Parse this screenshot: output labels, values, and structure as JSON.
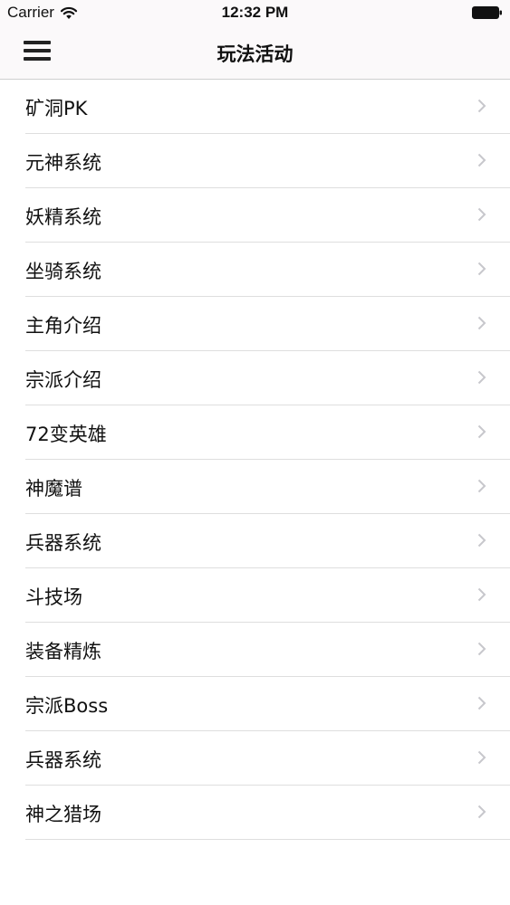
{
  "status_bar": {
    "carrier": "Carrier",
    "time": "12:32 PM",
    "wifi_icon": "wifi-icon",
    "battery_icon": "battery-icon"
  },
  "nav": {
    "title": "玩法活动",
    "menu_icon": "hamburger-menu-icon"
  },
  "list": {
    "items": [
      {
        "label": "矿洞PK"
      },
      {
        "label": "元神系统"
      },
      {
        "label": "妖精系统"
      },
      {
        "label": "坐骑系统"
      },
      {
        "label": "主角介绍"
      },
      {
        "label": "宗派介绍"
      },
      {
        "label": "72变英雄"
      },
      {
        "label": "神魔谱"
      },
      {
        "label": "兵器系统"
      },
      {
        "label": "斗技场"
      },
      {
        "label": "装备精炼"
      },
      {
        "label": "宗派Boss"
      },
      {
        "label": "兵器系统"
      },
      {
        "label": "神之猎场"
      }
    ],
    "chevron_icon": "chevron-right-icon"
  },
  "colors": {
    "bar_background": "#fbf9fa",
    "separator": "#dedede",
    "chevron": "#c7c7cc",
    "text": "#111111"
  }
}
